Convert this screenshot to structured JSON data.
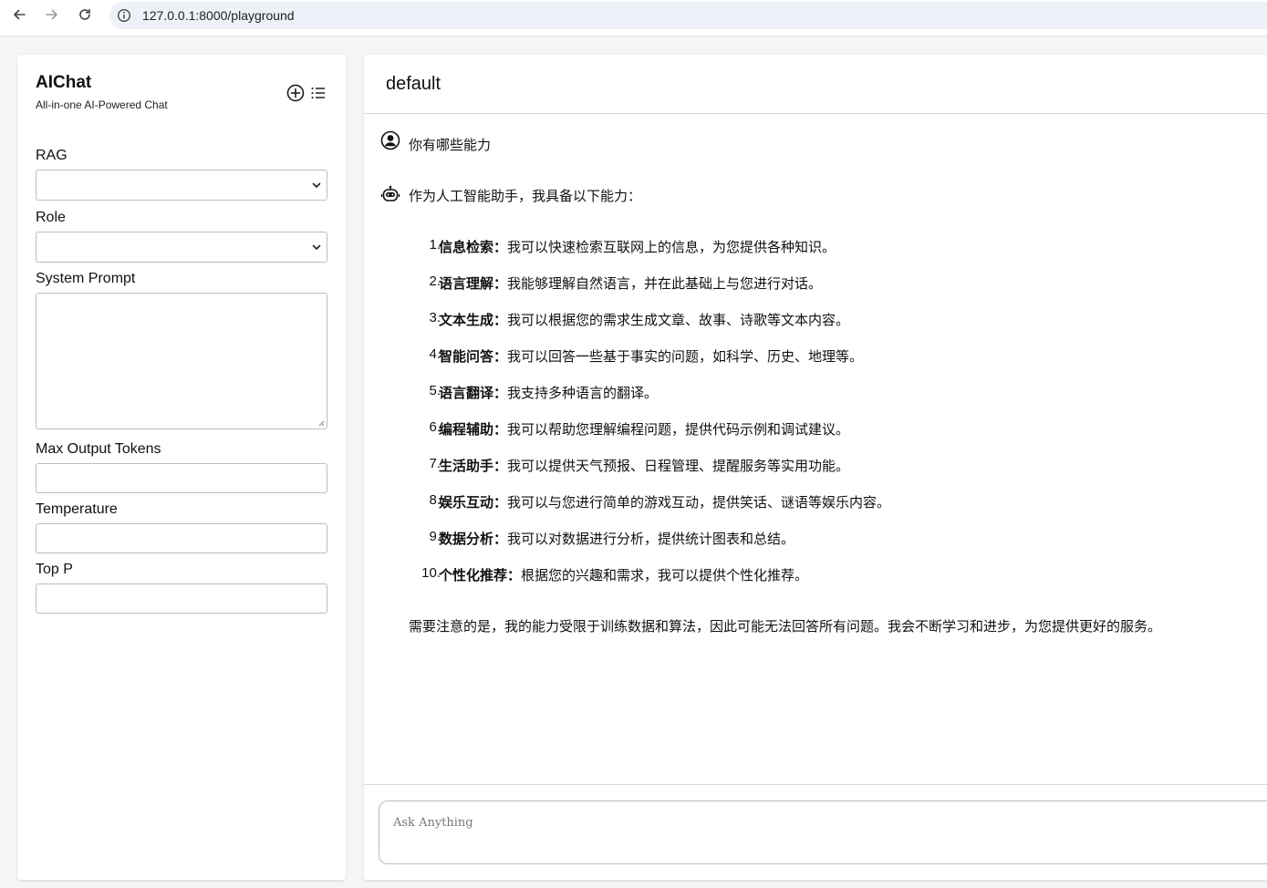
{
  "browser": {
    "url": "127.0.0.1:8000/playground",
    "icons": [
      "arrow-left-icon",
      "arrow-right-icon",
      "reload-icon",
      "site-info-icon"
    ]
  },
  "sidebar": {
    "app_title": "AIChat",
    "app_subtitle": "All-in-one AI-Powered Chat",
    "icons": [
      "new-chat-plus-icon",
      "chat-list-icon"
    ],
    "rag_label": "RAG",
    "rag_value": "",
    "role_label": "Role",
    "role_value": "",
    "system_prompt_label": "System Prompt",
    "system_prompt_value": "",
    "max_output_tokens_label": "Max Output Tokens",
    "max_output_tokens_value": "",
    "temperature_label": "Temperature",
    "temperature_value": "",
    "top_p_label": "Top P",
    "top_p_value": ""
  },
  "chat": {
    "title": "default",
    "user_message": "你有哪些能力",
    "assistant_intro": "作为人工智能助手，我具备以下能力：",
    "capabilities": [
      {
        "num": "1.",
        "term": "信息检索",
        "sep": "：",
        "text": "我可以快速检索互联网上的信息，为您提供各种知识。"
      },
      {
        "num": "2.",
        "term": "语言理解",
        "sep": "：",
        "text": "我能够理解自然语言，并在此基础上与您进行对话。"
      },
      {
        "num": "3.",
        "term": "文本生成",
        "sep": "：",
        "text": "我可以根据您的需求生成文章、故事、诗歌等文本内容。"
      },
      {
        "num": "4.",
        "term": "智能问答",
        "sep": "：",
        "text": "我可以回答一些基于事实的问题，如科学、历史、地理等。"
      },
      {
        "num": "5.",
        "term": "语言翻译",
        "sep": "：",
        "text": "我支持多种语言的翻译。"
      },
      {
        "num": "6.",
        "term": "编程辅助",
        "sep": "：",
        "text": "我可以帮助您理解编程问题，提供代码示例和调试建议。"
      },
      {
        "num": "7.",
        "term": "生活助手",
        "sep": "：",
        "text": "我可以提供天气预报、日程管理、提醒服务等实用功能。"
      },
      {
        "num": "8.",
        "term": "娱乐互动",
        "sep": "：",
        "text": "我可以与您进行简单的游戏互动，提供笑话、谜语等娱乐内容。"
      },
      {
        "num": "9.",
        "term": "数据分析",
        "sep": "：",
        "text": "我可以对数据进行分析，提供统计图表和总结。"
      },
      {
        "num": "10.",
        "term": "个性化推荐",
        "sep": "：",
        "text": "根据您的兴趣和需求，我可以提供个性化推荐。"
      }
    ],
    "assistant_note": "需要注意的是，我的能力受限于训练数据和算法，因此可能无法回答所有问题。我会不断学习和进步，为您提供更好的服务。",
    "input_placeholder": "Ask Anything",
    "icons": [
      "user-avatar-icon",
      "robot-icon"
    ]
  }
}
